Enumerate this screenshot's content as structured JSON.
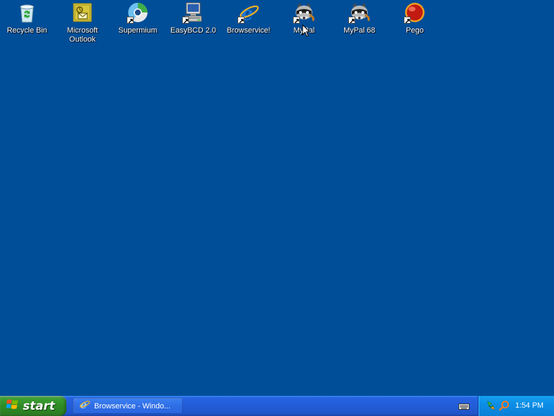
{
  "desktop": {
    "background": "#004e98",
    "icons": [
      {
        "label": "Recycle Bin",
        "icon": "recycle-bin-icon"
      },
      {
        "label": "Microsoft Outlook",
        "icon": "outlook-icon"
      },
      {
        "label": "Supermium",
        "icon": "supermium-icon"
      },
      {
        "label": "EasyBCD 2.0",
        "icon": "easybcd-icon"
      },
      {
        "label": "Browservice!",
        "icon": "internet-explorer-icon"
      },
      {
        "label": "MyPal",
        "icon": "mypal-raccoon-icon"
      },
      {
        "label": "MyPal 68",
        "icon": "mypal-raccoon-icon"
      },
      {
        "label": "Pego",
        "icon": "pego-icon"
      }
    ]
  },
  "taskbar": {
    "start_label": "start",
    "task_label": "Browservice - Windo...",
    "clock": "1:54 PM"
  },
  "colors": {
    "taskbar": "#245edb",
    "start_green": "#3c9c32",
    "tray": "#0c8ee6"
  }
}
